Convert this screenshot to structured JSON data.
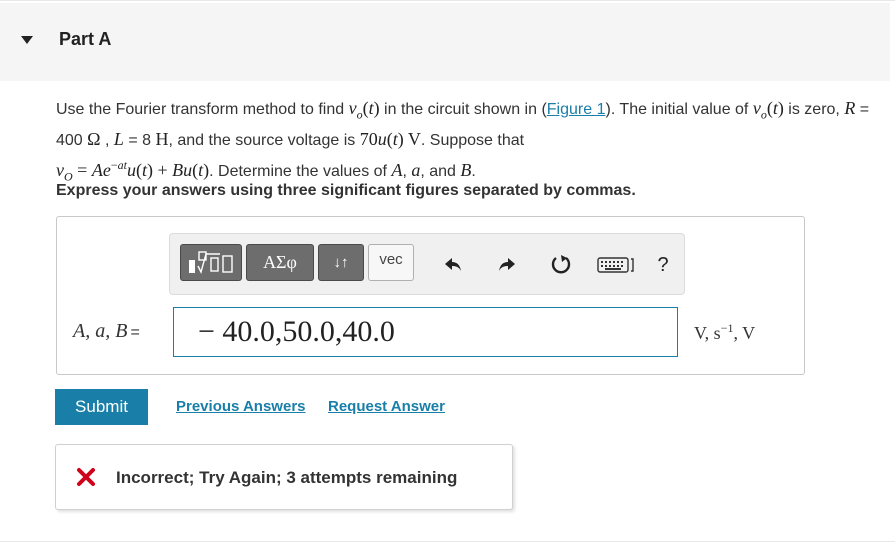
{
  "part": {
    "title": "Part A"
  },
  "problem": {
    "t1": "Use the Fourier transform method to find",
    "t2": "in the circuit shown in (",
    "figure_link": "Figure 1",
    "t3": "). The initial value of",
    "t4": "is zero,",
    "R_eq": "R",
    "R_val": " = 400 ",
    "ohm": "Ω",
    "L_eq": "L",
    "L_val": " = 8 ",
    "henry": "H",
    "t5": ", and the source voltage is",
    "source": "70u(t) V",
    "t6": ". Suppose that",
    "t7": ". Determine the values of",
    "A": "A",
    "a": "a",
    "B": "B",
    "and": ", and",
    "period": "."
  },
  "instruction": "Express your answers using three significant figures separated by commas.",
  "toolbar": {
    "greek_label": "ΑΣφ",
    "arrows_label": "↓↑",
    "vec_label": "vec",
    "help_label": "?"
  },
  "answer": {
    "label": "A, a, B",
    "equals": "=",
    "value": "− 40.0,50.0,40.0",
    "units": "V, s"
  },
  "actions": {
    "submit": "Submit",
    "previous_answers": "Previous Answers",
    "request_answer": "Request Answer"
  },
  "feedback": {
    "message": "Incorrect; Try Again; 3 attempts remaining",
    "icon": "x-icon",
    "icon_color": "#d0021b"
  },
  "colors": {
    "accent": "#1a7fa8",
    "header_bg": "#f5f5f5"
  }
}
